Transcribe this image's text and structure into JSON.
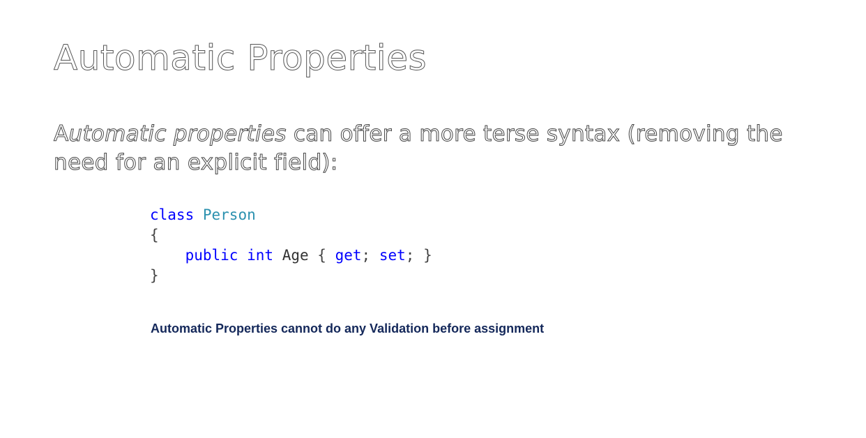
{
  "slide": {
    "title": "Automatic Properties",
    "intro": {
      "lead_letter": "A",
      "emphasis": "utomatic properties",
      "rest": " can offer a more terse syntax (removing the need for an explicit field):"
    },
    "code": {
      "line1": {
        "keyword": "class",
        "type_name": "Person"
      },
      "line2": {
        "brace": "{"
      },
      "line3": {
        "indent": "    ",
        "modifier": "public",
        "type": "int",
        "name": "Age",
        "open": "{",
        "get": "get",
        "sep1": ";",
        "set": "set",
        "sep2": ";",
        "close": "}"
      },
      "line4": {
        "brace": "}"
      }
    },
    "note": "Automatic Properties cannot do any Validation before assignment",
    "colors": {
      "keyword": "#0000ff",
      "type": "#2b91af",
      "note": "#14285a"
    }
  }
}
